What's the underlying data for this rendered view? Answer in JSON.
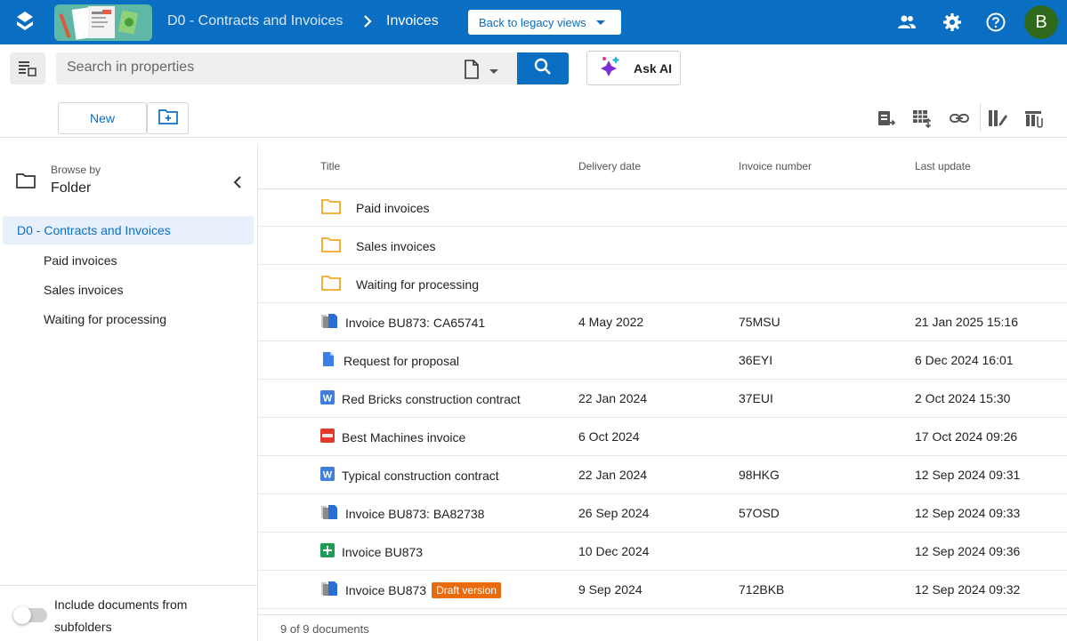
{
  "header": {
    "vault_name": "D0 - Contracts and Invoices",
    "breadcrumb_separator": "›",
    "current_view": "Invoices",
    "legacy_button": "Back to legacy views",
    "avatar_initial": "B",
    "brand_color": "#0a6fc2"
  },
  "search": {
    "placeholder": "Search in properties",
    "ask_ai_label": "Ask AI"
  },
  "toolbar": {
    "new_label": "New"
  },
  "sidebar": {
    "browse_by_label": "Browse by",
    "browse_mode": "Folder",
    "root": "D0 - Contracts and Invoices",
    "items": [
      {
        "label": "Paid invoices"
      },
      {
        "label": "Sales invoices"
      },
      {
        "label": "Waiting for processing"
      }
    ],
    "include_subfolders_label": "Include documents from subfolders"
  },
  "table": {
    "columns": [
      "Title",
      "Delivery date",
      "Invoice number",
      "Last update"
    ],
    "folders": [
      {
        "title": "Paid invoices"
      },
      {
        "title": "Sales invoices"
      },
      {
        "title": "Waiting for processing"
      }
    ],
    "documents": [
      {
        "icon": "multi-file-icon",
        "title": "Invoice BU873: CA65741",
        "delivery": "4 May 2022",
        "number": "75MSU",
        "updated": "21 Jan 2025 15:16"
      },
      {
        "icon": "doc-file-icon",
        "title": "Request for proposal",
        "delivery": "",
        "number": "36EYI",
        "updated": "6 Dec 2024 16:01"
      },
      {
        "icon": "word-file-icon",
        "title": "Red Bricks construction contract",
        "delivery": "22 Jan 2024",
        "number": "37EUI",
        "updated": "2 Oct 2024 15:30"
      },
      {
        "icon": "pdf-file-icon",
        "title": "Best Machines invoice",
        "delivery": "6 Oct 2024",
        "number": "",
        "updated": "17 Oct 2024 09:26"
      },
      {
        "icon": "word-file-icon",
        "title": "Typical construction contract",
        "delivery": "22 Jan 2024",
        "number": "98HKG",
        "updated": "12 Sep 2024 09:31"
      },
      {
        "icon": "multi-file-icon",
        "title": "Invoice BU873: BA82738",
        "delivery": "26 Sep 2024",
        "number": "57OSD",
        "updated": "12 Sep 2024 09:33"
      },
      {
        "icon": "sheet-file-icon",
        "title": "Invoice BU873",
        "delivery": "10 Dec 2024",
        "number": "",
        "updated": "12 Sep 2024 09:36"
      },
      {
        "icon": "multi-file-icon",
        "title": "Invoice BU873",
        "badge": "Draft version",
        "delivery": "9 Sep 2024",
        "number": "712BKB",
        "updated": "12 Sep 2024 09:32"
      }
    ]
  },
  "footer": {
    "count": "9 of 9 documents"
  }
}
